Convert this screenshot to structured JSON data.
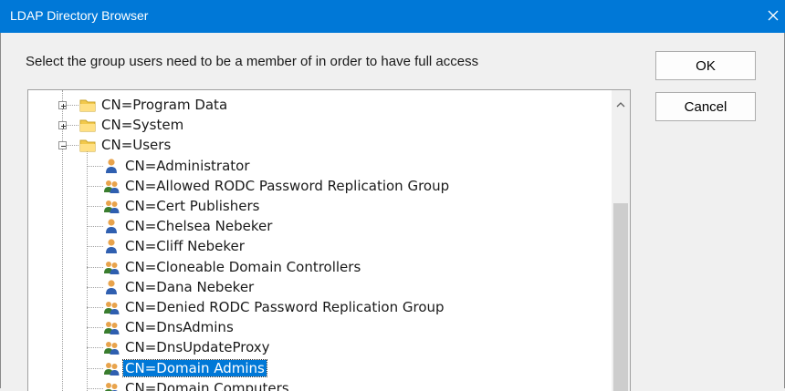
{
  "window": {
    "title": "LDAP Directory Browser",
    "prompt": "Select the group users need to be a member of in order to have full access"
  },
  "buttons": {
    "ok": "OK",
    "cancel": "Cancel"
  },
  "icons": {
    "close": "close-icon",
    "folder": "folder-icon",
    "user": "user-icon",
    "group": "group-icon",
    "scroll_up": "chevron-up-icon"
  },
  "colors": {
    "titlebar": "#0078d7",
    "selection": "#0078d7"
  },
  "tree": {
    "folders": [
      {
        "label": "CN=Program Data",
        "expanded": false
      },
      {
        "label": "CN=System",
        "expanded": false
      },
      {
        "label": "CN=Users",
        "expanded": true
      }
    ],
    "users": [
      {
        "label": "CN=Administrator",
        "type": "user"
      },
      {
        "label": "CN=Allowed RODC Password Replication Group",
        "type": "group"
      },
      {
        "label": "CN=Cert Publishers",
        "type": "group"
      },
      {
        "label": "CN=Chelsea Nebeker",
        "type": "user"
      },
      {
        "label": "CN=Cliff Nebeker",
        "type": "user"
      },
      {
        "label": "CN=Cloneable Domain Controllers",
        "type": "group"
      },
      {
        "label": "CN=Dana Nebeker",
        "type": "user"
      },
      {
        "label": "CN=Denied RODC Password Replication Group",
        "type": "group"
      },
      {
        "label": "CN=DnsAdmins",
        "type": "group"
      },
      {
        "label": "CN=DnsUpdateProxy",
        "type": "group"
      },
      {
        "label": "CN=Domain Admins",
        "type": "group",
        "selected": true
      },
      {
        "label": "CN=Domain Computers",
        "type": "group"
      }
    ]
  }
}
